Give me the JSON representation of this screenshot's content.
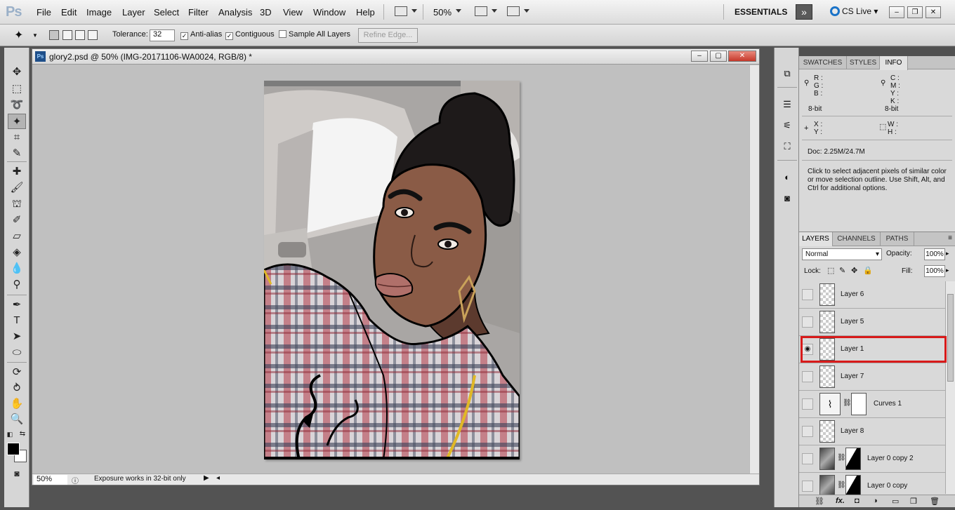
{
  "app": {
    "logo": "Ps",
    "menu": [
      "File",
      "Edit",
      "Image",
      "Layer",
      "Select",
      "Filter",
      "Analysis",
      "3D",
      "View",
      "Window",
      "Help"
    ],
    "zoom": "50%",
    "workspace": "ESSENTIALS",
    "cs_live": "CS Live"
  },
  "options": {
    "tolerance_label": "Tolerance:",
    "tolerance_value": "32",
    "anti_alias": "Anti-alias",
    "contiguous": "Contiguous",
    "sample_all": "Sample All Layers",
    "refine_edge": "Refine Edge..."
  },
  "document": {
    "title": "glory2.psd @ 50% (IMG-20171106-WA0024, RGB/8) *",
    "zoom": "50%",
    "status": "Exposure works in 32-bit only"
  },
  "info_panel": {
    "tabs": [
      "SWATCHES",
      "STYLES",
      "INFO"
    ],
    "active_tab": "INFO",
    "rgb": [
      "R :",
      "G :",
      "B :"
    ],
    "cmyk": [
      "C :",
      "M :",
      "Y :",
      "K :"
    ],
    "bits_left": "8-bit",
    "bits_right": "8-bit",
    "xy": [
      "X :",
      "Y :"
    ],
    "wh": [
      "W :",
      "H :"
    ],
    "doc": "Doc: 2.25M/24.7M",
    "hint": "Click to select adjacent pixels of similar color or move selection outline.  Use Shift, Alt, and Ctrl for additional options."
  },
  "layers_panel": {
    "tabs": [
      "LAYERS",
      "CHANNELS",
      "PATHS"
    ],
    "active_tab": "LAYERS",
    "blend_mode": "Normal",
    "opacity_label": "Opacity:",
    "opacity": "100%",
    "lock_label": "Lock:",
    "fill_label": "Fill:",
    "fill": "100%",
    "layers": [
      {
        "name": "Layer 6",
        "visible": false
      },
      {
        "name": "Layer 5",
        "visible": false
      },
      {
        "name": "Layer 1",
        "visible": true,
        "highlighted": true
      },
      {
        "name": "Layer 7",
        "visible": false
      },
      {
        "name": "Curves 1",
        "visible": false
      },
      {
        "name": "Layer 8",
        "visible": false
      },
      {
        "name": "Layer 0 copy 2",
        "visible": false
      },
      {
        "name": "Layer 0 copy",
        "visible": false
      }
    ],
    "highlight_color": "#d81a1a"
  },
  "icons": {
    "tools": [
      "move-icon",
      "marquee-icon",
      "lasso-icon",
      "magic-wand-icon",
      "crop-icon",
      "eyedropper-icon",
      "healing-icon",
      "brush-icon",
      "clone-stamp-icon",
      "history-brush-icon",
      "eraser-icon",
      "paint-bucket-icon",
      "blur-icon",
      "dodge-icon",
      "pen-icon",
      "type-icon",
      "path-select-icon",
      "ellipse-icon",
      "3d-rotate-icon",
      "3d-orbit-icon",
      "hand-icon",
      "zoom-icon"
    ]
  }
}
